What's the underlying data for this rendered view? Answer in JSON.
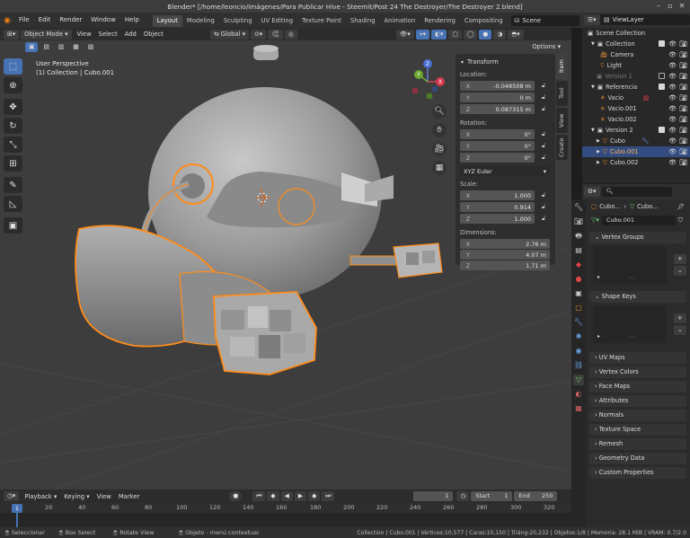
{
  "titlebar": {
    "title": "Blender* [/home/leoncio/Imágenes/Para Publicar Hive - Steemit/Post 24 The Destroyer/The Destroyer 2.blend]"
  },
  "menu": {
    "items": [
      "File",
      "Edit",
      "Render",
      "Window",
      "Help"
    ]
  },
  "workspaces": [
    "Layout",
    "Modeling",
    "Sculpting",
    "UV Editing",
    "Texture Paint",
    "Shading",
    "Animation",
    "Rendering",
    "Compositing"
  ],
  "scene": {
    "name": "Scene"
  },
  "viewlayer": {
    "name": "ViewLayer"
  },
  "viewport_header": {
    "mode": "Object Mode",
    "menus": [
      "View",
      "Select",
      "Add",
      "Object"
    ],
    "orientation": "Global",
    "options": "Options"
  },
  "viewport_info": {
    "line1": "User Perspective",
    "line2": "(1) Collection | Cubo.001"
  },
  "gizmo": {
    "x": "X",
    "y": "Y",
    "z": "Z"
  },
  "npanel": {
    "title": "Transform",
    "location_label": "Location:",
    "location": [
      {
        "axis": "X",
        "value": "-0.048508 m"
      },
      {
        "axis": "Y",
        "value": "0 m"
      },
      {
        "axis": "Z",
        "value": "0.087315 m"
      }
    ],
    "rotation_label": "Rotation:",
    "rotation": [
      {
        "axis": "X",
        "value": "0°"
      },
      {
        "axis": "Y",
        "value": "0°"
      },
      {
        "axis": "Z",
        "value": "0°"
      }
    ],
    "rotation_mode": "XYZ Euler",
    "scale_label": "Scale:",
    "scale": [
      {
        "axis": "X",
        "value": "1.000"
      },
      {
        "axis": "Y",
        "value": "0.914"
      },
      {
        "axis": "Z",
        "value": "1.000"
      }
    ],
    "dimensions_label": "Dimensions:",
    "dimensions": [
      {
        "axis": "X",
        "value": "2.76 m"
      },
      {
        "axis": "Y",
        "value": "4.07 m"
      },
      {
        "axis": "Z",
        "value": "1.71 m"
      }
    ],
    "tabs": [
      "Item",
      "Tool",
      "View",
      "Create"
    ]
  },
  "outliner": {
    "rows": [
      {
        "label": "Scene Collection",
        "selected": false
      },
      {
        "label": "Collection",
        "selected": false
      },
      {
        "label": "Camera",
        "selected": false
      },
      {
        "label": "Light",
        "selected": false
      },
      {
        "label": "Version 1",
        "selected": false
      },
      {
        "label": "Referencia",
        "selected": false
      },
      {
        "label": "Vacio",
        "selected": false
      },
      {
        "label": "Vacio.001",
        "selected": false
      },
      {
        "label": "Vacio.002",
        "selected": false
      },
      {
        "label": "Version 2",
        "selected": false
      },
      {
        "label": "Cubo",
        "selected": false
      },
      {
        "label": "Cubo.001",
        "selected": true
      },
      {
        "label": "Cubo.002",
        "selected": false
      }
    ]
  },
  "properties": {
    "breadcrumb_object": "Cubo...",
    "breadcrumb_mesh": "Cubo...",
    "mesh_name": "Cubo.001",
    "sections": [
      "Vertex Groups",
      "Shape Keys",
      "UV Maps",
      "Vertex Colors",
      "Face Maps",
      "Attributes",
      "Normals",
      "Texture Space",
      "Remesh",
      "Geometry Data",
      "Custom Properties"
    ]
  },
  "timeline": {
    "menus": [
      "Playback",
      "Keying",
      "View",
      "Marker"
    ],
    "current_frame": "1",
    "start_label": "Start",
    "start": "1",
    "end_label": "End",
    "end": "250",
    "ruler": [
      "20",
      "40",
      "60",
      "80",
      "100",
      "120",
      "140",
      "160",
      "180",
      "200",
      "220",
      "240",
      "260",
      "280",
      "300",
      "320"
    ],
    "playhead": "1"
  },
  "statusbar": {
    "select": "Seleccionar",
    "box_select": "Box Select",
    "rotate_view": "Rotate View",
    "context_menu": "Objeto - menú contextual",
    "stats": "Collection | Cubo.001 | Vértices:10,577 | Caras:10,150 | Triáng:20,232 | Objetos:1/8 | Memoria: 28.1 MiB | VRAM: 0.7/2.0"
  },
  "colors": {
    "accent": "#4772b3",
    "selection": "#ff8c1a",
    "active_blue": "#334d80"
  }
}
